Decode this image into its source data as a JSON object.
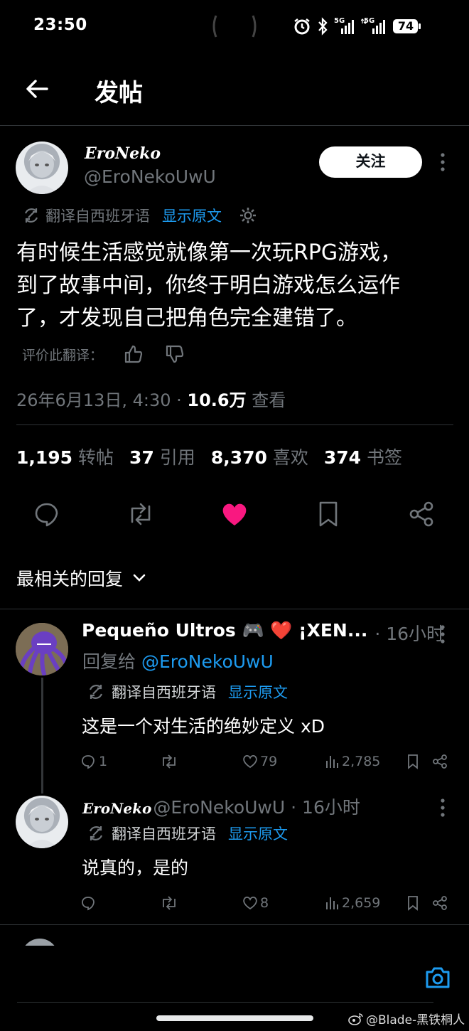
{
  "status_bar": {
    "time": "23:50",
    "battery": "74",
    "signal_1": "5G",
    "signal_2": "5G"
  },
  "header": {
    "title": "发帖"
  },
  "post": {
    "display_name": "EroNeko",
    "handle": "@EroNekoUwU",
    "follow_label": "关注",
    "translate_label": "翻译自西班牙语",
    "show_original_label": "显示原文",
    "text": "有时候生活感觉就像第一次玩RPG游戏，\n到了故事中间，你终于明白游戏怎么运作\n了，才发现自己把角色完全建错了。",
    "rate_translation_label": "评价此翻译：",
    "timestamp": "26年6月13日, 4:30 · ",
    "views_count": "10.6万",
    "views_label": " 查看",
    "stats": {
      "reposts": "1,195",
      "reposts_label": "转帖",
      "quotes": "37",
      "quotes_label": "引用",
      "likes": "8,370",
      "likes_label": "喜欢",
      "bookmarks": "374",
      "bookmarks_label": "书签"
    }
  },
  "replies_filter": {
    "label": "最相关的回复"
  },
  "replies": [
    {
      "display_name": "Pequeño Ultros 🎮 ❤️ ¡XEN...",
      "time": "· 16小时",
      "reply_to_prefix": "回复给 ",
      "reply_to_handle": "@EroNekoUwU",
      "translate_label": "翻译自西班牙语",
      "show_original_label": "显示原文",
      "text": "这是一个对生活的绝妙定义 xD",
      "replies_count": "1",
      "likes_count": "79",
      "views_count": "2,785"
    },
    {
      "display_name": "EroNeko",
      "handle": "@EroNekoUwU",
      "time": "· 16小时",
      "translate_label": "翻译自西班牙语",
      "show_original_label": "显示原文",
      "text": "说真的，是的",
      "likes_count": "8",
      "views_count": "2,659"
    }
  ],
  "watermark": {
    "text": "@Blade-黑铁桐人"
  },
  "colors": {
    "accent": "#1d9bf0",
    "like": "#f91880",
    "muted": "#71767b",
    "background": "#000000"
  }
}
